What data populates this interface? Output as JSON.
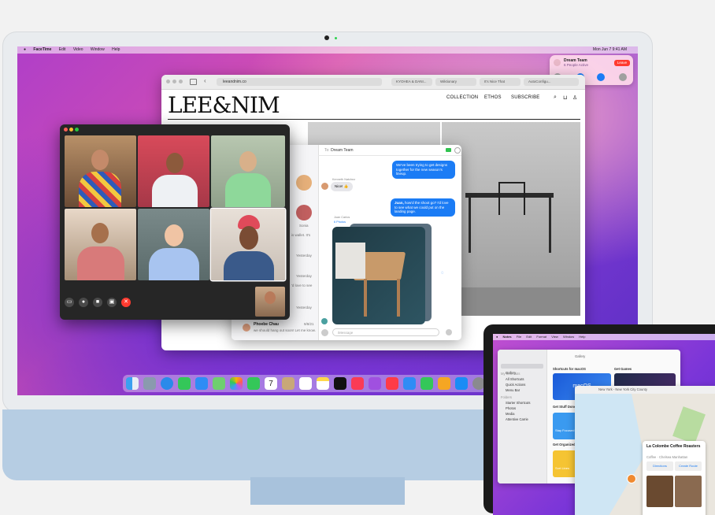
{
  "imac": {
    "menubar": {
      "app_menus": [
        "FaceTime",
        "Edit",
        "Video",
        "Window",
        "Help"
      ],
      "clock": "Mon Jun 7  9:41 AM"
    },
    "notification": {
      "title": "Dream Team",
      "subtitle": "6 People Active",
      "leave_label": "Leave"
    },
    "safari": {
      "url": "leeandnim.co",
      "tabs": [
        "KYOHEA & DANI...",
        "Wiktionary",
        "It's Nice That",
        "AutoConfigu..."
      ],
      "site_logo": "LEE&NIM",
      "nav": [
        "COLLECTION",
        "ETHOS",
        "SUBSCRIBE"
      ]
    },
    "messages": {
      "to_label": "To:",
      "conversation": "Dream Team",
      "sidebar_names": [
        "Sonia",
        "Phoebe Chau"
      ],
      "sidebar_snippets": [
        "is wallet. It's",
        "Yesterday",
        "Yesterday",
        "'d love to see",
        "Yesterday"
      ],
      "phoebe_time": "9/8/21",
      "phoebe_snippet": "we should hang out soon! Let me know.",
      "msg1": "We've been trying to get designs together for the new season's lineup.",
      "sender2": "Kenneth Natchez",
      "msg2": "Nice! 👍",
      "msg3_bold": "Juan,",
      "msg3": " how'd the shoot go? I'd love to see what we could put on the landing page.",
      "sender4": "Juan Carlos",
      "photos_label": "6 Photos",
      "compose_placeholder": "iMessage"
    },
    "dock_icons": [
      "finder-icon",
      "launchpad-icon",
      "safari-icon",
      "messages-icon",
      "mail-icon",
      "maps-icon",
      "photos-icon",
      "facetime-icon",
      "calendar-icon",
      "contacts-icon",
      "reminders-icon",
      "notes-icon",
      "tv-icon",
      "music-icon",
      "podcasts-icon",
      "news-icon",
      "keynote-icon",
      "numbers-icon",
      "pages-icon",
      "app-store-icon",
      "system-preferences-icon"
    ],
    "calendar_day": "7"
  },
  "macbook": {
    "menubar": [
      "Notes",
      "File",
      "Edit",
      "Format",
      "View",
      "Window",
      "Help"
    ],
    "notes": {
      "gallery_label": "Gallery",
      "sidebar": [
        "Gallery",
        "My Shortcuts",
        "All Shortcuts",
        "Quick Actions",
        "Menu Bar",
        "Folders",
        "Starter Shortcuts",
        "Photos",
        "Media",
        "Attentive Carrie"
      ],
      "sections": [
        "Shortcuts for macOS",
        "Get Games",
        "Get Stuff Done",
        "Get Organized"
      ],
      "card1": "macOS",
      "card_stay": "Stay Focused",
      "card_sort": "Sort Lines"
    },
    "maps": {
      "location": "New York - New York City County",
      "place_name": "La Colombe Coffee Roasters",
      "place_sub": "Coffee · Chelsea Manhattan",
      "btn1": "Directions",
      "btn2": "Create Route"
    }
  },
  "colors": {
    "accent_blue": "#1b7cf5",
    "leave_red": "#ff3b30",
    "imac_blue": "#b6cde3"
  }
}
